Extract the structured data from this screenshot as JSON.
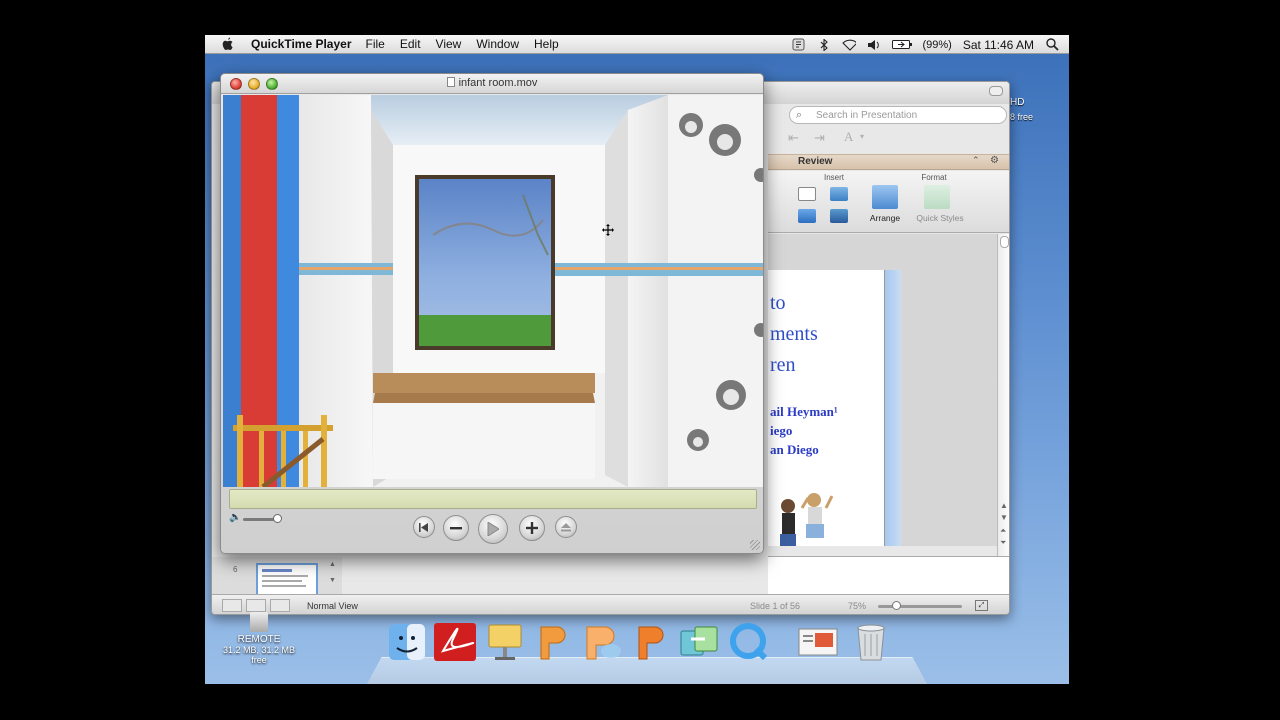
{
  "menubar": {
    "app_name": "QuickTime Player",
    "menus": [
      "File",
      "Edit",
      "View",
      "Window",
      "Help"
    ],
    "battery_percent": "(99%)",
    "clock": "Sat 11:46 AM"
  },
  "desktop": {
    "hd_label": "HD",
    "hd_free": "8 free",
    "remote_name": "REMOTE",
    "remote_size": "31.2 MB, 31.2 MB free"
  },
  "powerpoint": {
    "search_placeholder": "Search in Presentation",
    "review_tab": "Review",
    "group_insert": "Insert",
    "group_format": "Format",
    "arrange_label": "Arrange",
    "quick_styles_label": "Quick Styles",
    "slide_title_lines": [
      "to",
      "ments",
      "ren"
    ],
    "slide_author_lines": [
      "ail Heyman¹",
      "iego",
      "an Diego"
    ],
    "status_view": "Normal View",
    "status_slide": "Slide 1 of 56",
    "status_zoom": "75%",
    "thumb_number": "6"
  },
  "quicktime": {
    "window_title": "infant room.mov",
    "controls": {
      "rewind": "rewind-icon",
      "slower": "minus-icon",
      "play": "play-icon",
      "faster": "plus-icon",
      "end": "eject-icon"
    }
  },
  "dock": {
    "items": [
      "finder-icon",
      "acrobat-icon",
      "keynote-icon",
      "powerpoint-icon-1",
      "powerpoint-icon-2",
      "powerpoint-icon-3",
      "migration-icon",
      "quicktime-icon",
      "preview-icon",
      "trash-icon"
    ]
  },
  "colors": {
    "desktop_blue": "#5d8ed0",
    "slide_title_blue": "#2f4fc9",
    "scrub_green": "#e4e9c6"
  }
}
